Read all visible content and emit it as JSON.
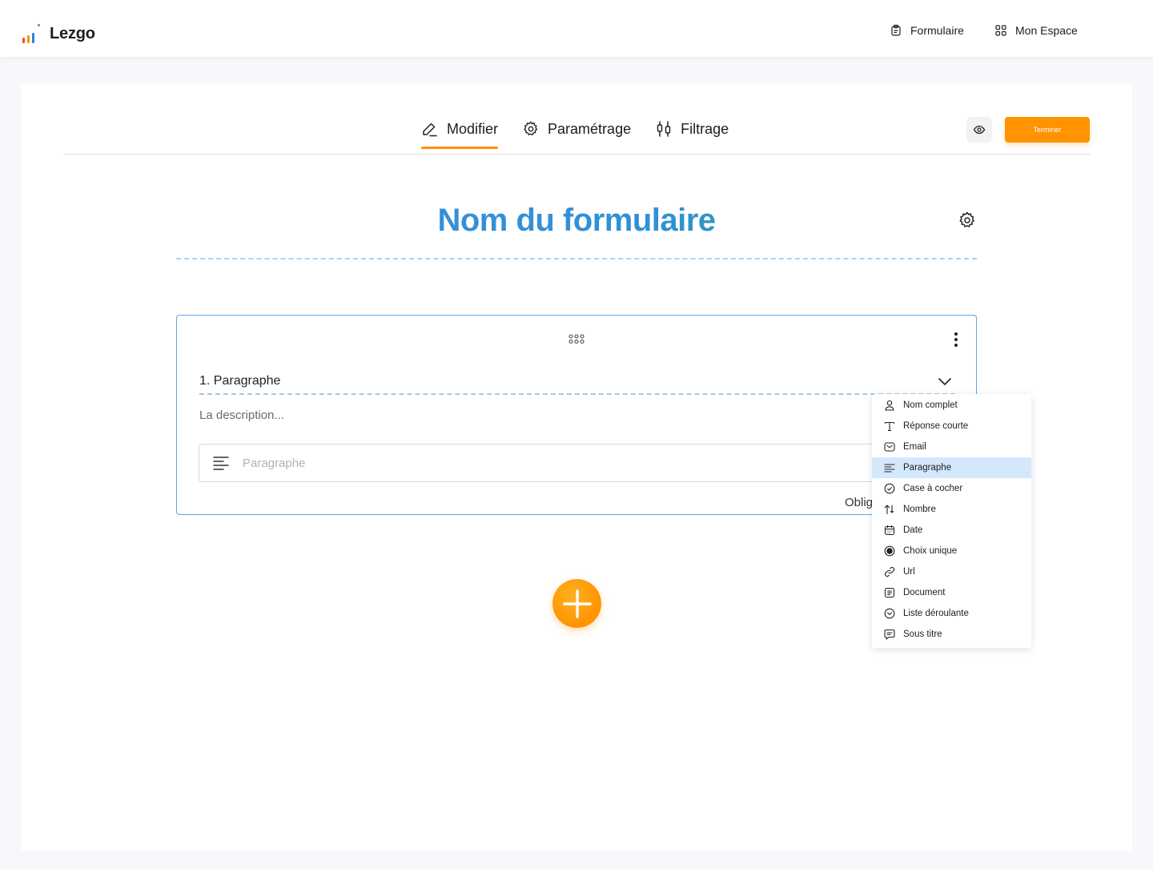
{
  "app": {
    "name": "Lezgo"
  },
  "nav": {
    "formulaire": "Formulaire",
    "espace": "Mon Espace"
  },
  "tabs": [
    {
      "label": "Modifier",
      "active": true
    },
    {
      "label": "Paramétrage",
      "active": false
    },
    {
      "label": "Filtrage",
      "active": false
    }
  ],
  "actions": {
    "finish": "Terminer"
  },
  "form": {
    "title": "Nom du formulaire"
  },
  "question": {
    "label": "1. Paragraphe",
    "description": "La description...",
    "placeholder": "Paragraphe",
    "required_label": "Oblig"
  },
  "type_menu": {
    "selected": "Paragraphe",
    "items": [
      {
        "label": "Nom complet",
        "icon": "person-icon"
      },
      {
        "label": "Réponse courte",
        "icon": "text-t-icon"
      },
      {
        "label": "Email",
        "icon": "envelope-icon"
      },
      {
        "label": "Paragraphe",
        "icon": "paragraph-icon"
      },
      {
        "label": "Case à cocher",
        "icon": "check-circle-icon"
      },
      {
        "label": "Nombre",
        "icon": "sort-arrows-icon"
      },
      {
        "label": "Date",
        "icon": "calendar-icon"
      },
      {
        "label": "Choix unique",
        "icon": "radio-icon"
      },
      {
        "label": "Url",
        "icon": "link-icon"
      },
      {
        "label": "Document",
        "icon": "document-icon"
      },
      {
        "label": "Liste déroulante",
        "icon": "chevron-circle-icon"
      },
      {
        "label": "Sous titre",
        "icon": "message-icon"
      }
    ]
  },
  "colors": {
    "accent": "#ff9300",
    "focus_border": "#5aa6e6",
    "selected_row": "#d3e8fb"
  }
}
